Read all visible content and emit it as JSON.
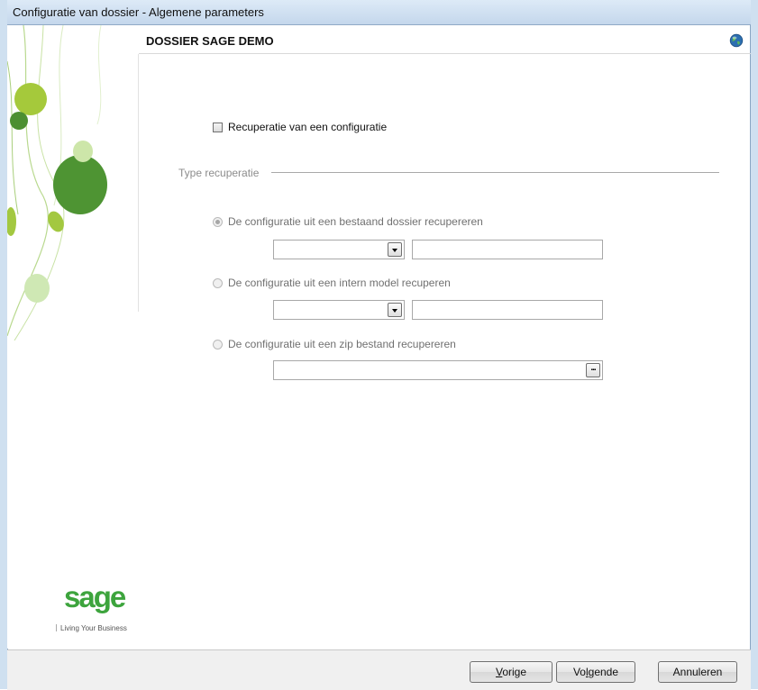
{
  "window": {
    "title": "Configuratie van dossier - Algemene parameters"
  },
  "header": {
    "dossier_name": "DOSSIER SAGE DEMO"
  },
  "recovery": {
    "checkbox_label": "Recuperatie van een configuratie",
    "checkbox_checked": false,
    "group_label": "Type recuperatie",
    "options": [
      {
        "label": "De configuratie uit een bestaand dossier recupereren",
        "selected": true,
        "enabled": false
      },
      {
        "label": "De configuratie uit een intern model recuperen",
        "selected": false,
        "enabled": false
      },
      {
        "label": "De configuratie uit een zip bestand recupereren",
        "selected": false,
        "enabled": false
      }
    ],
    "browse_button": "..."
  },
  "branding": {
    "logo": "sage",
    "tagline": "Living Your Business"
  },
  "footer": {
    "back_mnemonic": "V",
    "back_rest": "orige",
    "next_prefix": "Vo",
    "next_mnemonic": "l",
    "next_rest": "gende",
    "cancel_label": "Annuleren"
  },
  "colors": {
    "accent_green": "#3da43d",
    "titlebar": "#c4d7ec",
    "disabled_text": "#707070"
  },
  "icons": [
    "globe-icon",
    "chevron-down-icon",
    "ellipsis-icon"
  ]
}
